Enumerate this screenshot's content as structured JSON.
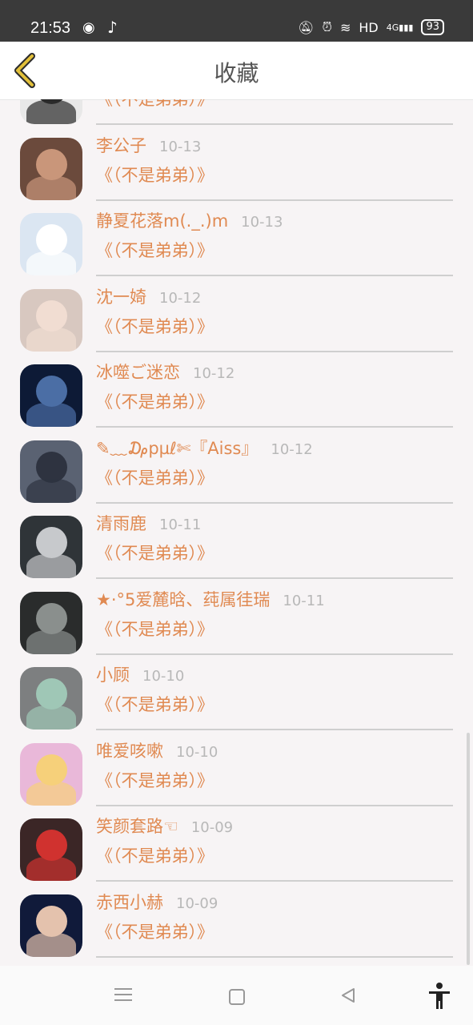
{
  "status": {
    "time": "21:53",
    "network": "HD",
    "signal_label": "4G",
    "battery": "93"
  },
  "header": {
    "title": "收藏",
    "back_icon": "chevron-left-icon",
    "accent": "#e2c03a"
  },
  "items": [
    {
      "name": "",
      "date": "",
      "message": "《（不是弟弟）》",
      "avatar_colors": [
        "#e8e8e8",
        "#2b2b2b"
      ]
    },
    {
      "name": "李公子",
      "date": "10-13",
      "message": "《（不是弟弟）》",
      "avatar_colors": [
        "#6b4a3c",
        "#c9967a"
      ]
    },
    {
      "name": "静夏花落m(._.)m",
      "date": "10-13",
      "message": "《（不是弟弟）》",
      "avatar_colors": [
        "#dbe6f2",
        "#ffffff"
      ]
    },
    {
      "name": "沈一婍",
      "date": "10-12",
      "message": "《（不是弟弟）》",
      "avatar_colors": [
        "#d8c8c0",
        "#f1ddd2"
      ]
    },
    {
      "name": "冰噬ご迷恋",
      "date": "10-12",
      "message": "《（不是弟弟）》",
      "avatar_colors": [
        "#0d1a36",
        "#4b6ea5"
      ]
    },
    {
      "name": "✎﹏₯pµℓ✄『Aiss』",
      "date": "10-12",
      "message": "《（不是弟弟）》",
      "avatar_colors": [
        "#5a6272",
        "#2e3340"
      ]
    },
    {
      "name": "清雨鹿",
      "date": "10-11",
      "message": "《（不是弟弟）》",
      "avatar_colors": [
        "#2f3438",
        "#c7c9cc"
      ]
    },
    {
      "name": "★·°5爱麓晗、莼属徍瑞",
      "date": "10-11",
      "message": "《（不是弟弟）》",
      "avatar_colors": [
        "#2a2c2c",
        "#8a8f8d"
      ]
    },
    {
      "name": "小顾",
      "date": "10-10",
      "message": "《（不是弟弟）》",
      "avatar_colors": [
        "#7d7f80",
        "#9fc7b6"
      ]
    },
    {
      "name": "唯爱咳嗽",
      "date": "10-10",
      "message": "《（不是弟弟）》",
      "avatar_colors": [
        "#e9b8d9",
        "#f6d07a"
      ]
    },
    {
      "name": "笑颜套路☜",
      "date": "10-09",
      "message": "《（不是弟弟）》",
      "avatar_colors": [
        "#3b2626",
        "#d0322f"
      ]
    },
    {
      "name": "赤西小赫",
      "date": "10-09",
      "message": "《（不是弟弟）》",
      "avatar_colors": [
        "#101a3a",
        "#e4c2ad"
      ]
    }
  ]
}
